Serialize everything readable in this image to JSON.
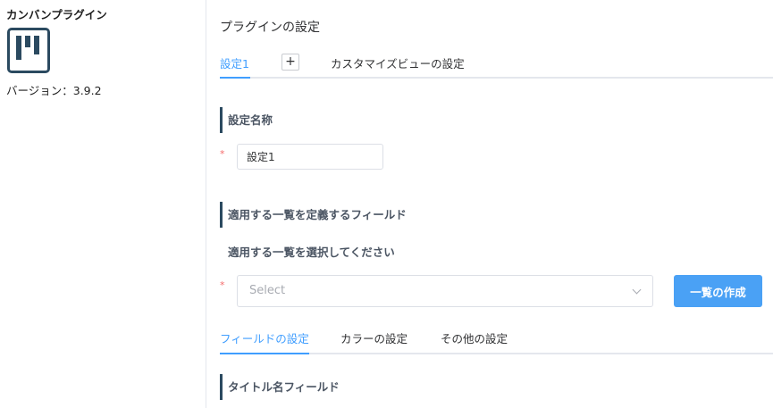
{
  "sidebar": {
    "plugin_name": "カンバンプラグイン",
    "version": "バージョン：3.9.2"
  },
  "main": {
    "title": "プラグインの設定",
    "settings_tabs": {
      "active": "設定1",
      "add": "+",
      "customize": "カスタマイズビューの設定"
    },
    "setting_name_heading": "設定名称",
    "setting_name_value": "設定1",
    "required_mark": "*",
    "list_field_heading": "適用する一覧を定義するフィールド",
    "select_list_label": "適用する一覧を選択してください",
    "select_placeholder": "Select",
    "create_list_button": "一覧の作成",
    "field_tabs": [
      "フィールドの設定",
      "カラーの設定",
      "その他の設定"
    ],
    "title_field_heading": "タイトル名フィールド"
  },
  "colors": {
    "accent": "#409eff",
    "button": "#4aa1f5",
    "heading_bar": "#2b4a60",
    "required": "#f56c6c"
  }
}
